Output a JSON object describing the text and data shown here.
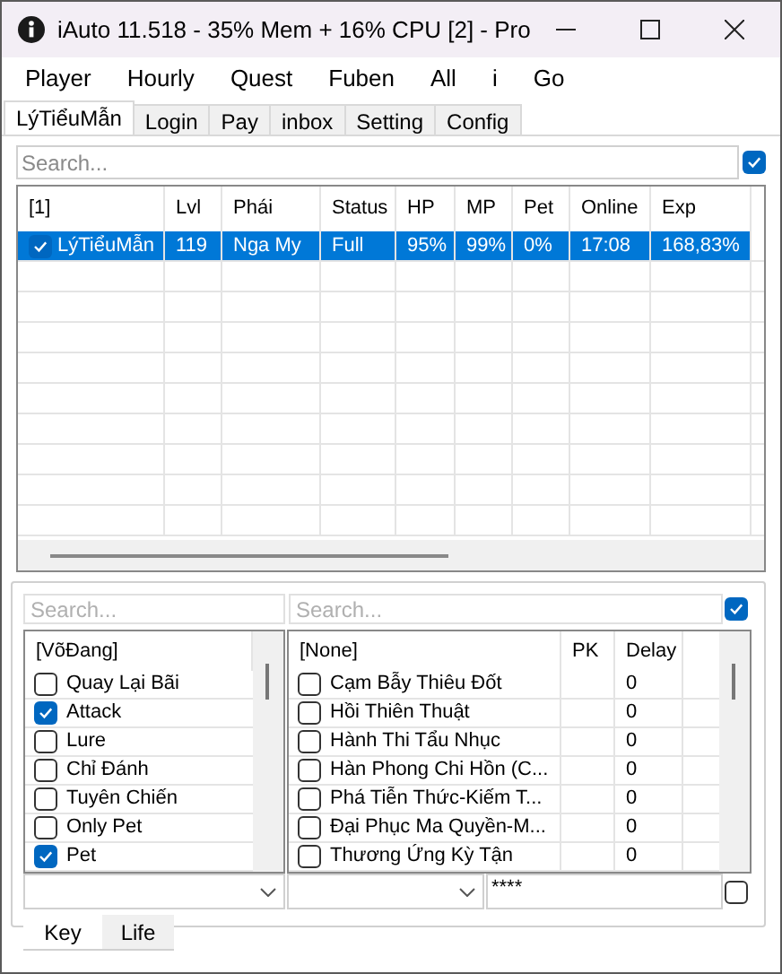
{
  "window": {
    "title": "iAuto 11.518 - 35% Mem + 16% CPU [2] - Pro"
  },
  "menu": [
    "Player",
    "Hourly",
    "Quest",
    "Fuben",
    "All",
    "i",
    "Go"
  ],
  "tabs": [
    {
      "label": "LýTiểuMẫn",
      "selected": true
    },
    {
      "label": "Login",
      "selected": false
    },
    {
      "label": "Pay",
      "selected": false
    },
    {
      "label": "inbox",
      "selected": false
    },
    {
      "label": "Setting",
      "selected": false
    },
    {
      "label": "Config",
      "selected": false
    }
  ],
  "search": {
    "placeholder": "Search...",
    "checked": true
  },
  "table": {
    "columns": [
      "[1]",
      "Lvl",
      "Phái",
      "Status",
      "HP",
      "MP",
      "Pet",
      "Online",
      "Exp"
    ],
    "rows": [
      {
        "checked": true,
        "selected": true,
        "cells": [
          "LýTiểuMẫn",
          "119",
          "Nga My",
          "Full",
          "95%",
          "99%",
          "0%",
          "17:08",
          "168,83%"
        ]
      }
    ]
  },
  "skill_search": {
    "placeholder": "Search..."
  },
  "skill_list": {
    "header": "[VõĐang]",
    "items": [
      {
        "label": "Quay Lại Bãi",
        "checked": false
      },
      {
        "label": "Attack",
        "checked": true
      },
      {
        "label": "Lure",
        "checked": false
      },
      {
        "label": "Chỉ Đánh",
        "checked": false
      },
      {
        "label": "Tuyên Chiến",
        "checked": false
      },
      {
        "label": "Only Pet",
        "checked": false
      },
      {
        "label": "Pet",
        "checked": true
      }
    ]
  },
  "skill_table_search": {
    "placeholder": "Search...",
    "checked": true
  },
  "skill_table": {
    "columns": [
      "[None]",
      "PK",
      "Delay"
    ],
    "rows": [
      {
        "name": "Cạm Bẫy Thiêu Đốt",
        "checked": false,
        "delay": "0"
      },
      {
        "name": "Hồi Thiên Thuật",
        "checked": false,
        "delay": "0"
      },
      {
        "name": "Hành Thi Tẩu Nhục",
        "checked": false,
        "delay": "0"
      },
      {
        "name": "Hàn Phong Chi Hồn (C...",
        "checked": false,
        "delay": "0"
      },
      {
        "name": "Phá Tiễn Thức-Kiếm T...",
        "checked": false,
        "delay": "0"
      },
      {
        "name": "Đại Phục Ma Quyền-M...",
        "checked": false,
        "delay": "0"
      },
      {
        "name": "Thương Ứng Kỳ Tận",
        "checked": false,
        "delay": "0"
      }
    ]
  },
  "password": {
    "value": "****",
    "checked": false
  },
  "bottom_tabs": [
    {
      "label": "Key",
      "selected": true
    },
    {
      "label": "Life",
      "selected": false
    }
  ]
}
